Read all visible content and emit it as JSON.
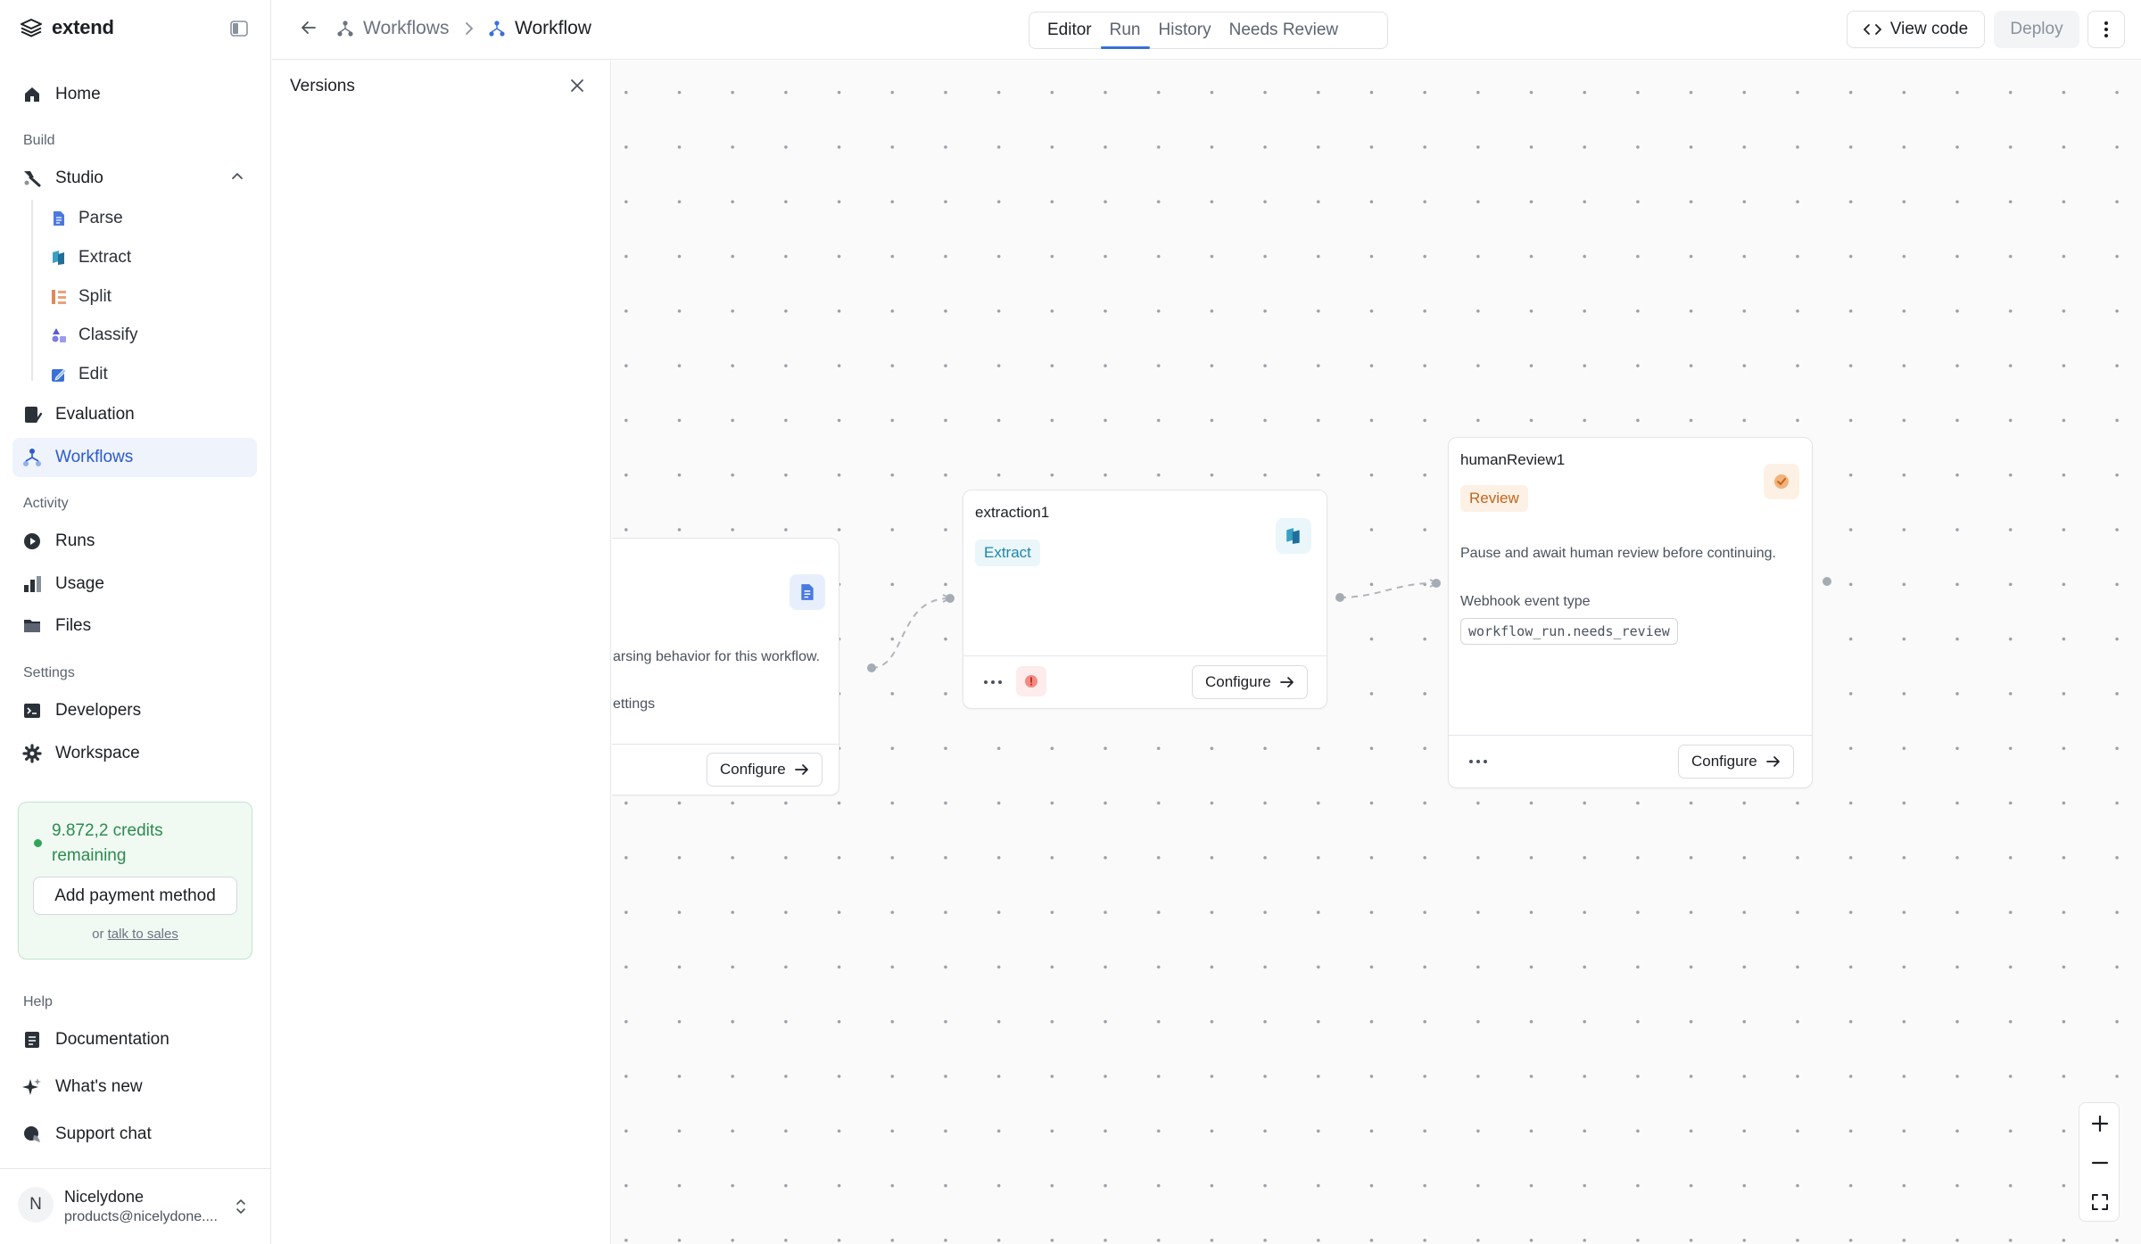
{
  "brand": {
    "name": "extend"
  },
  "sidebar": {
    "home": "Home",
    "build_label": "Build",
    "studio": "Studio",
    "studio_items": [
      {
        "label": "Parse",
        "icon": "parse-icon"
      },
      {
        "label": "Extract",
        "icon": "extract-icon"
      },
      {
        "label": "Split",
        "icon": "split-icon"
      },
      {
        "label": "Classify",
        "icon": "classify-icon"
      },
      {
        "label": "Edit",
        "icon": "edit-icon"
      }
    ],
    "evaluation": "Evaluation",
    "workflows": "Workflows",
    "activity_label": "Activity",
    "runs": "Runs",
    "usage": "Usage",
    "files": "Files",
    "settings_label": "Settings",
    "developers": "Developers",
    "workspace": "Workspace",
    "help_label": "Help",
    "documentation": "Documentation",
    "whats_new": "What's new",
    "support_chat": "Support chat"
  },
  "credits": {
    "text": "9.872,2 credits remaining",
    "pay_button": "Add payment method",
    "or": "or",
    "sales_link": "talk to sales"
  },
  "user": {
    "initial": "N",
    "name": "Nicelydone",
    "email": "products@nicelydone...."
  },
  "header": {
    "breadcrumb_parent": "Workflows",
    "breadcrumb_current": "Workflow",
    "tabs": [
      "Editor",
      "Run",
      "History",
      "Needs Review"
    ],
    "active_tab": "Run",
    "view_code": "View code",
    "deploy": "Deploy"
  },
  "versions": {
    "title": "Versions"
  },
  "nodes": {
    "parse": {
      "desc": "arsing behavior for this workflow.",
      "settings": "ettings",
      "configure": "Configure"
    },
    "extraction": {
      "title": "extraction1",
      "tag": "Extract",
      "configure": "Configure"
    },
    "review": {
      "title": "humanReview1",
      "tag": "Review",
      "desc": "Pause and await human review before continuing.",
      "webhook_label": "Webhook event type",
      "webhook_value": "workflow_run.needs_review",
      "configure": "Configure"
    }
  },
  "colors": {
    "accent": "#3a6fd8",
    "active_bg": "#eef3fc",
    "credits_green": "#2d8a4e",
    "extract_tag": "#1f86a8",
    "review_tag": "#c2661a"
  }
}
